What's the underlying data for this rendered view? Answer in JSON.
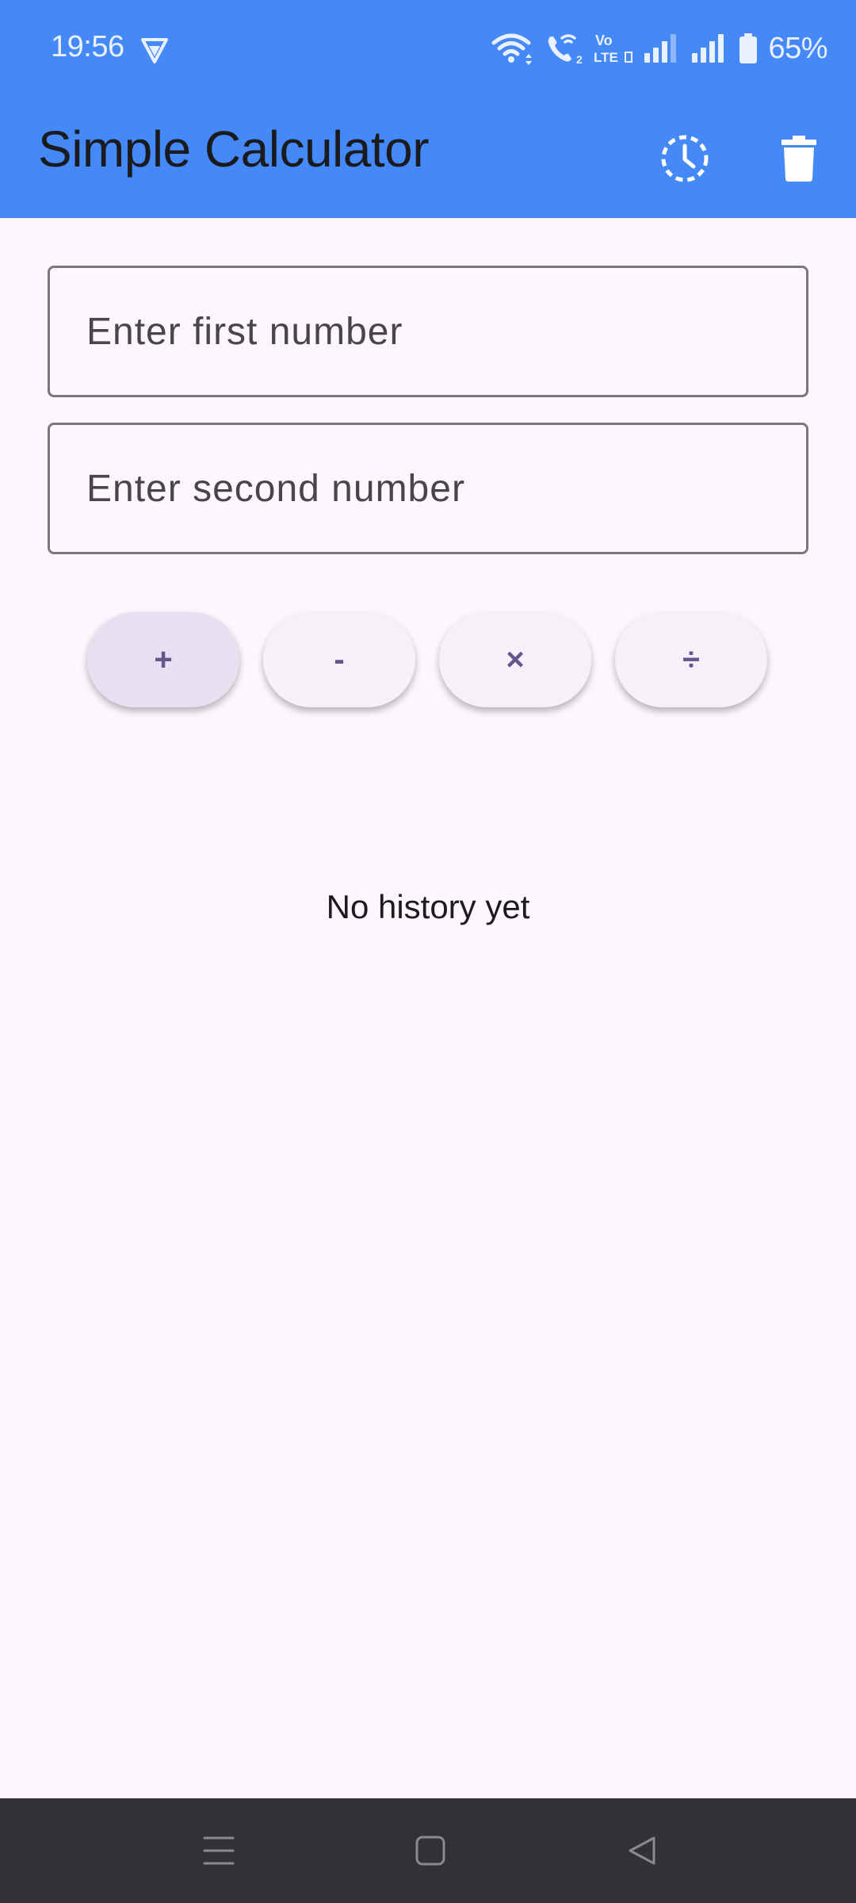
{
  "status_bar": {
    "time": "19:56",
    "battery": "65%",
    "icons": [
      "vpn-icon",
      "wifi-icon",
      "wifi-calling-icon",
      "volte-icon",
      "signal-icon",
      "signal-icon",
      "battery-icon"
    ]
  },
  "app_bar": {
    "title": "Simple Calculator",
    "actions": [
      "history-icon",
      "delete-icon"
    ],
    "color": "#4489f6"
  },
  "inputs": {
    "first_placeholder": "Enter first number",
    "second_placeholder": "Enter second number",
    "first_value": "",
    "second_value": ""
  },
  "operations": {
    "add": "+",
    "subtract": "-",
    "multiply": "×",
    "divide": "÷",
    "accent_color": "#65558f"
  },
  "history": {
    "empty_text": "No history yet"
  },
  "nav_bar": {
    "icons": [
      "menu-icon",
      "home-icon",
      "back-icon"
    ]
  }
}
